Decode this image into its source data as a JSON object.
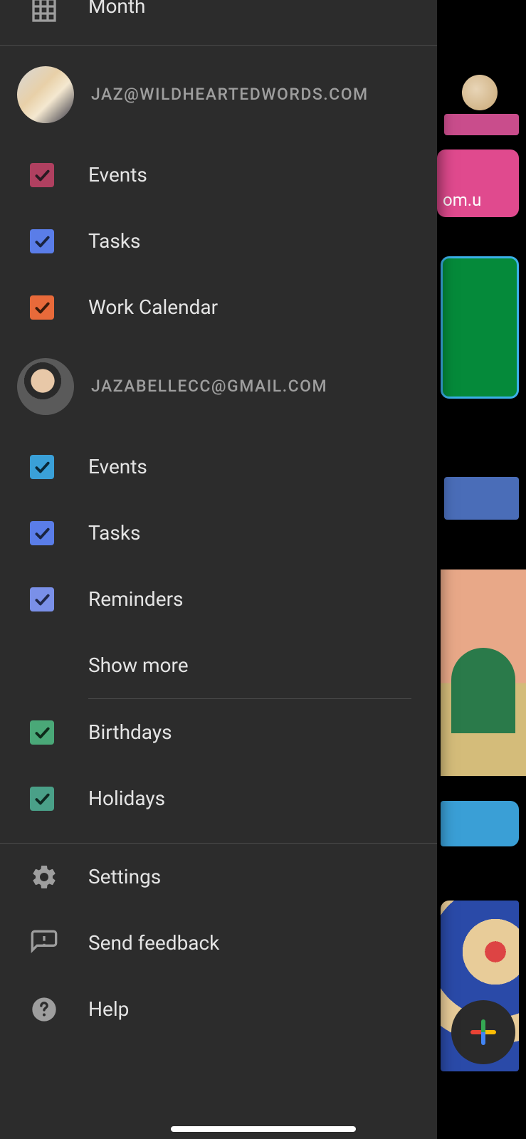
{
  "view_option": {
    "month_label": "Month"
  },
  "accounts": [
    {
      "email": "JAZ@WILDHEARTEDWORDS.COM",
      "calendars": [
        {
          "label": "Events",
          "color": "#b04060",
          "check_color": "#2a1a22"
        },
        {
          "label": "Tasks",
          "color": "#5a7de8",
          "check_color": "#1a2440"
        },
        {
          "label": "Work Calendar",
          "color": "#e86a3a",
          "check_color": "#3a1a0a"
        }
      ]
    },
    {
      "email": "JAZABELLECC@GMAIL.COM",
      "calendars": [
        {
          "label": "Events",
          "color": "#3aa0d8",
          "check_color": "#0a2838"
        },
        {
          "label": "Tasks",
          "color": "#5a7de8",
          "check_color": "#1a2440"
        },
        {
          "label": "Reminders",
          "color": "#7a90e8",
          "check_color": "#20284a"
        }
      ],
      "show_more_label": "Show more",
      "extras": [
        {
          "label": "Birthdays",
          "color": "#4aa878",
          "check_color": "#0e2a1a"
        },
        {
          "label": "Holidays",
          "color": "#4aa088",
          "check_color": "#0e2820"
        }
      ]
    }
  ],
  "footer": {
    "settings_label": "Settings",
    "feedback_label": "Send feedback",
    "help_label": "Help"
  },
  "backdrop": {
    "partial_text": "om.u"
  }
}
